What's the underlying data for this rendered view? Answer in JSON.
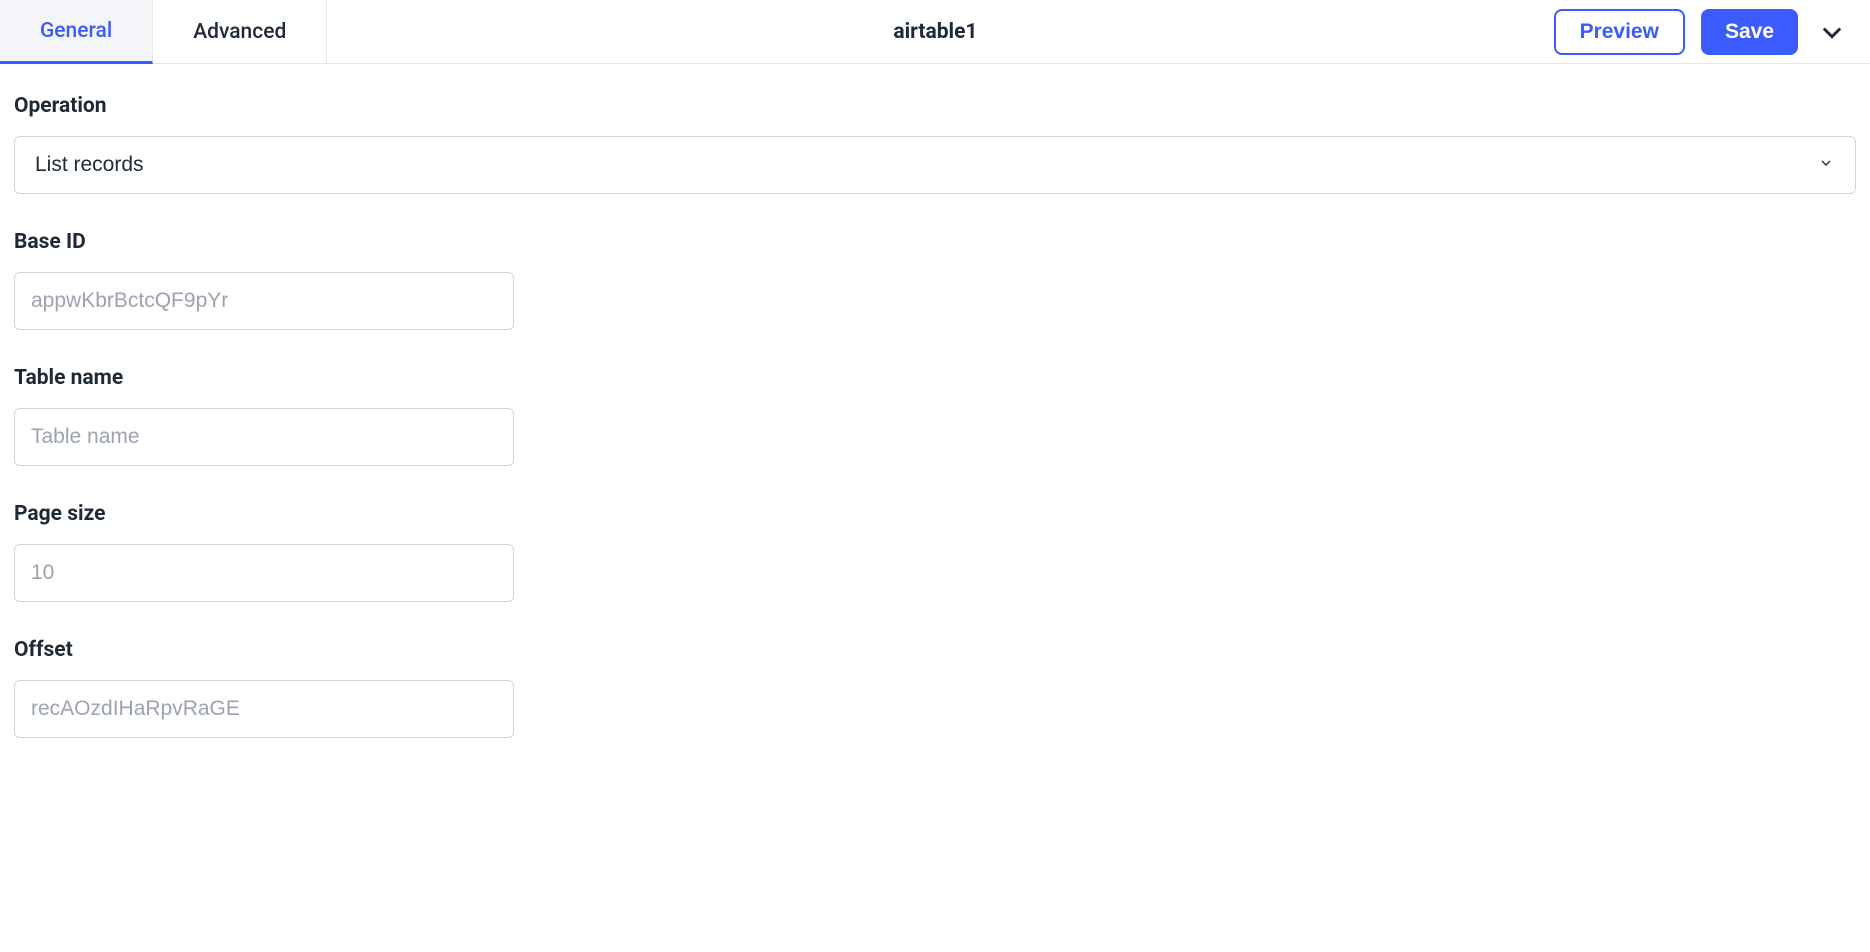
{
  "header": {
    "tabs": {
      "general": "General",
      "advanced": "Advanced"
    },
    "title": "airtable1",
    "preview_label": "Preview",
    "save_label": "Save"
  },
  "fields": {
    "operation": {
      "label": "Operation",
      "value": "List records"
    },
    "base_id": {
      "label": "Base ID",
      "placeholder": "appwKbrBctcQF9pYr",
      "value": ""
    },
    "table_name": {
      "label": "Table name",
      "placeholder": "Table name",
      "value": ""
    },
    "page_size": {
      "label": "Page size",
      "placeholder": "10",
      "value": ""
    },
    "offset": {
      "label": "Offset",
      "placeholder": "recAOzdIHaRpvRaGE",
      "value": ""
    }
  }
}
